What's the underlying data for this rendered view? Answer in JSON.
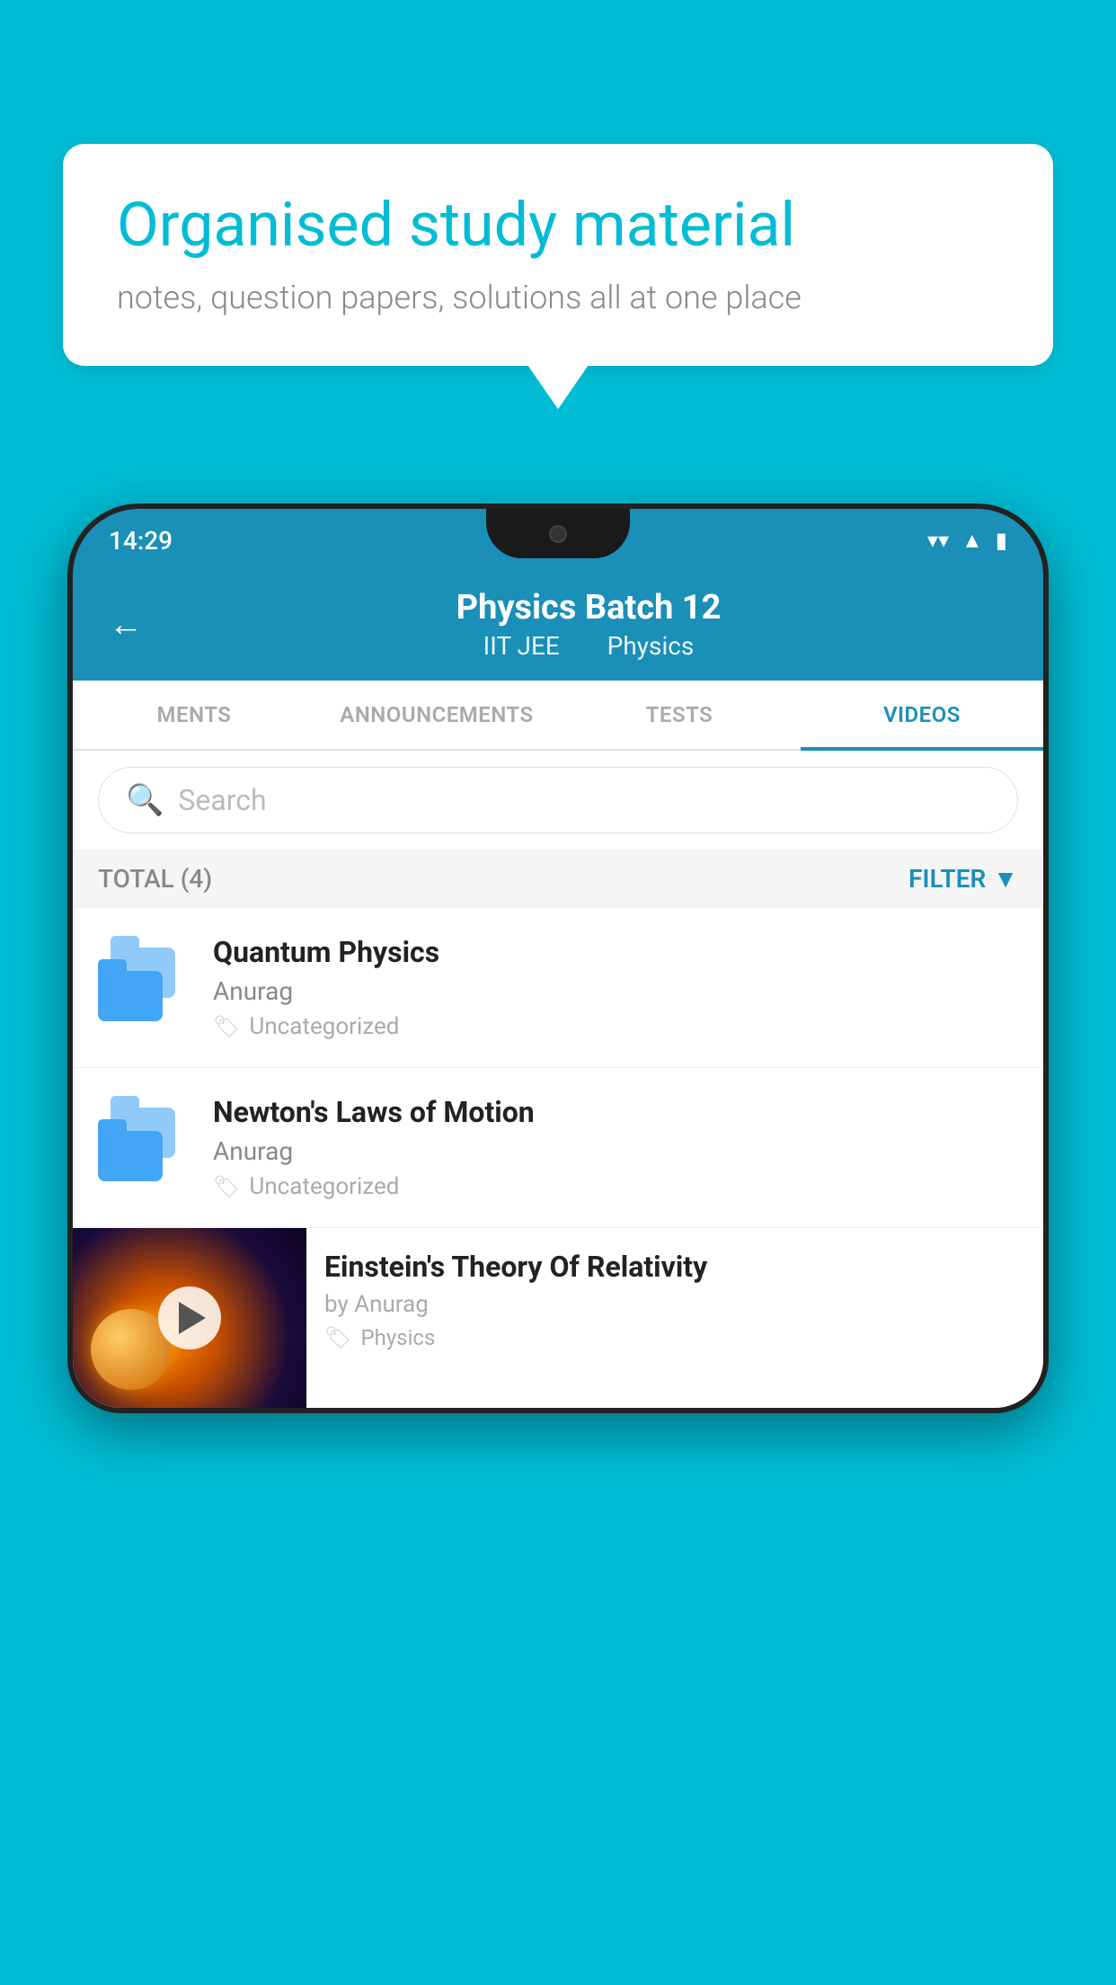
{
  "page": {
    "background_color": "#00bcd4"
  },
  "speech_bubble": {
    "title": "Organised study material",
    "subtitle": "notes, question papers, solutions all at one place"
  },
  "phone": {
    "status_bar": {
      "time": "14:29"
    },
    "header": {
      "back_label": "←",
      "title": "Physics Batch 12",
      "subtitle_parts": [
        "IIT JEE",
        "Physics"
      ]
    },
    "tabs": [
      {
        "label": "MENTS",
        "active": false
      },
      {
        "label": "ANNOUNCEMENTS",
        "active": false
      },
      {
        "label": "TESTS",
        "active": false
      },
      {
        "label": "VIDEOS",
        "active": true
      }
    ],
    "search": {
      "placeholder": "Search"
    },
    "filter_bar": {
      "total_label": "TOTAL (4)",
      "filter_label": "FILTER"
    },
    "videos": [
      {
        "title": "Quantum Physics",
        "author": "Anurag",
        "tag": "Uncategorized",
        "type": "folder"
      },
      {
        "title": "Newton's Laws of Motion",
        "author": "Anurag",
        "tag": "Uncategorized",
        "type": "folder"
      },
      {
        "title": "Einstein's Theory Of Relativity",
        "author": "by Anurag",
        "tag": "Physics",
        "type": "thumbnail"
      }
    ]
  }
}
